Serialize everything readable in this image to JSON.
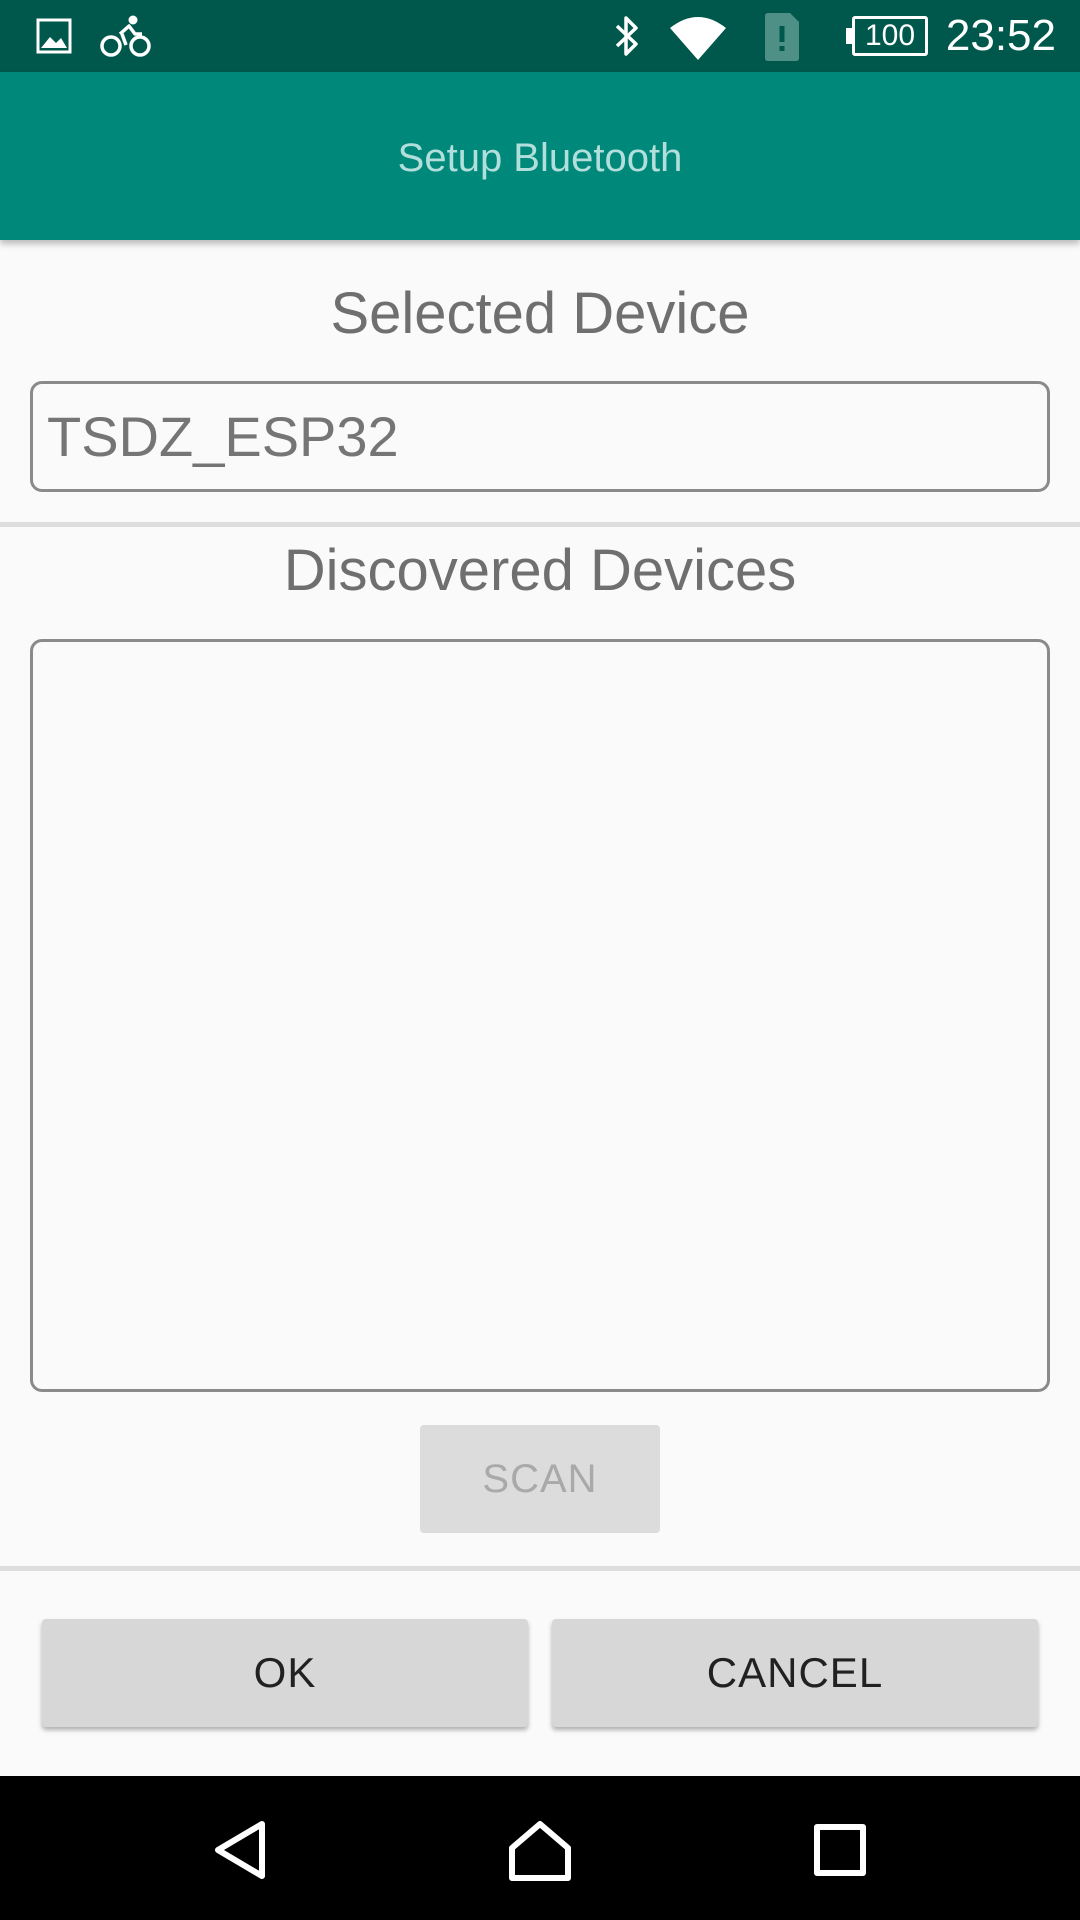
{
  "status_bar": {
    "icons": [
      "image-icon",
      "bicycle-icon",
      "bluetooth-icon",
      "wifi-icon",
      "sim-alert-icon"
    ],
    "battery_level": "100",
    "time": "23:52"
  },
  "app_bar": {
    "title": "Setup Bluetooth"
  },
  "selected_device": {
    "heading": "Selected Device",
    "value": "TSDZ_ESP32"
  },
  "discovered_devices": {
    "heading": "Discovered Devices",
    "items": []
  },
  "buttons": {
    "scan": "SCAN",
    "ok": "OK",
    "cancel": "CANCEL"
  },
  "nav_bar": {
    "icons": [
      "back-icon",
      "home-icon",
      "recents-icon"
    ]
  },
  "colors": {
    "status_bar": "#00574b",
    "app_bar": "#00897b",
    "app_bar_title": "#b2dfdb",
    "background": "#fafafa"
  }
}
